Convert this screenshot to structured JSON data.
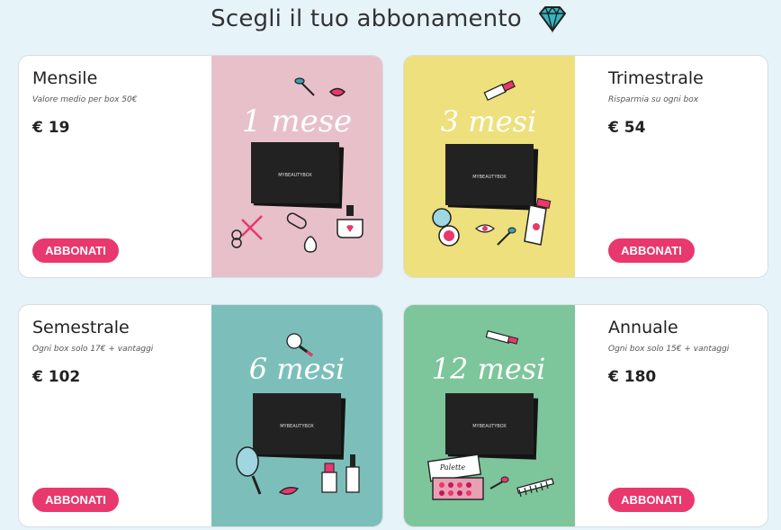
{
  "header": {
    "title": "Scegli il tuo abbonamento",
    "icon": "diamond-icon"
  },
  "colors": {
    "background": "#e6f3f9",
    "button": "#e8386d",
    "monthly_art": "#e8c0c9",
    "quarterly_art": "#ede07d",
    "semiannual_art": "#7cbfba",
    "annual_art": "#7dc59a"
  },
  "plans": [
    {
      "name": "Mensile",
      "subtitle": "Valore medio per box 50€",
      "price": "€ 19",
      "button": "ABBONATI",
      "art_text": "1 mese",
      "box_label": "MYBEAUTYBOX"
    },
    {
      "name": "Trimestrale",
      "subtitle": "Risparmia su ogni box",
      "price": "€ 54",
      "button": "ABBONATI",
      "art_text": "3 mesi",
      "box_label": "MYBEAUTYBOX"
    },
    {
      "name": "Semestrale",
      "subtitle": "Ogni box solo 17€ + vantaggi",
      "price": "€ 102",
      "button": "ABBONATI",
      "art_text": "6 mesi",
      "box_label": "MYBEAUTYBOX"
    },
    {
      "name": "Annuale",
      "subtitle": "Ogni box solo 15€ + vantaggi",
      "price": "€ 180",
      "button": "ABBONATI",
      "art_text": "12 mesi",
      "box_label": "MYBEAUTYBOX",
      "palette_label": "Palette"
    }
  ]
}
